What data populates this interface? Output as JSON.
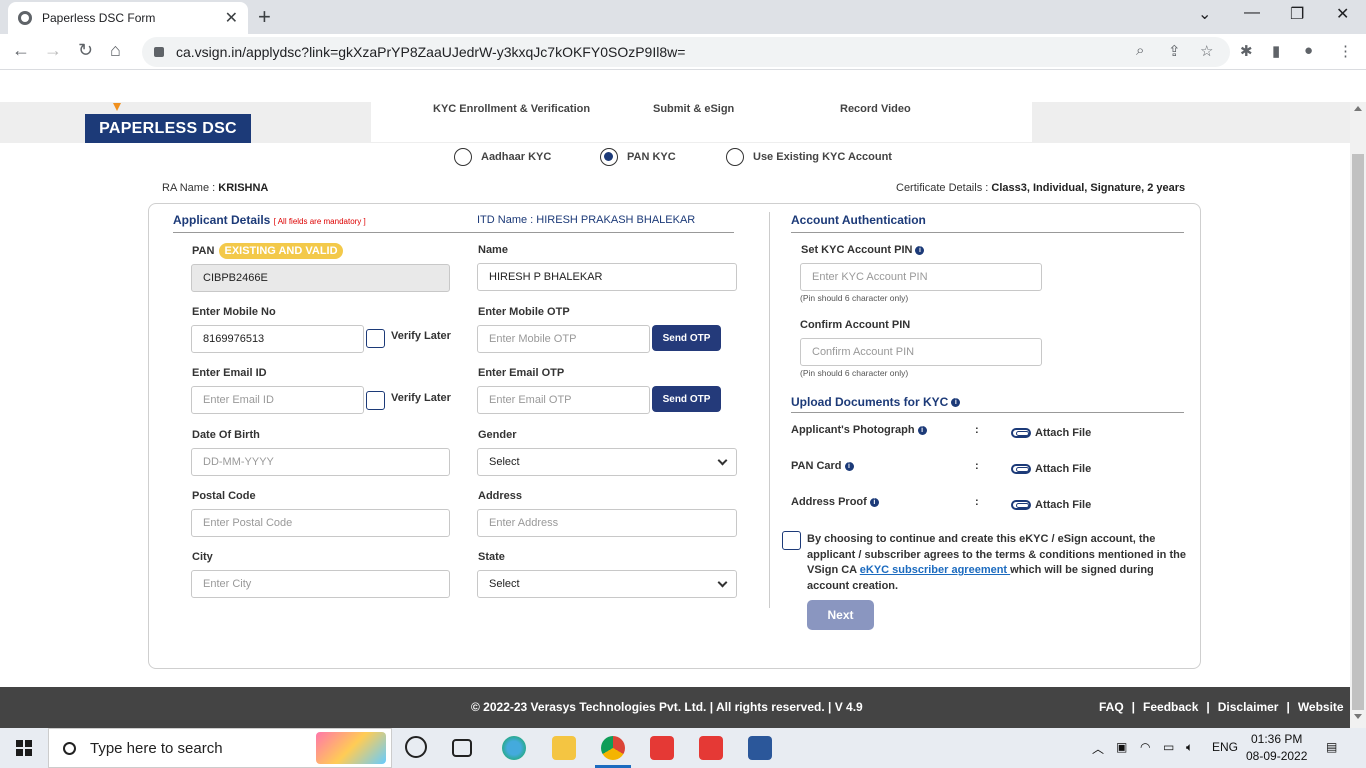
{
  "browser": {
    "tab_title": "Paperless DSC Form",
    "url": "ca.vsign.in/applydsc?link=gkXzaPrYP8ZaaUJedrW-y3kxqJc7kOKFY0SOzP9Il8w="
  },
  "header": {
    "logo": "PAPERLESS DSC",
    "steps": [
      "KYC Enrollment & Verification",
      "Submit & eSign",
      "Record Video"
    ]
  },
  "kyc_options": [
    {
      "label": "Aadhaar KYC",
      "selected": false
    },
    {
      "label": "PAN KYC",
      "selected": true
    },
    {
      "label": "Use Existing KYC Account",
      "selected": false
    }
  ],
  "ra": {
    "label": "RA Name : ",
    "value": "KRISHNA"
  },
  "cert": {
    "label": "Certificate Details : ",
    "value": "Class3, Individual, Signature, 2 years"
  },
  "applicant": {
    "title": "Applicant Details",
    "mandatory": "[ All fields are mandatory ]",
    "itd_name": "ITD Name : HIRESH PRAKASH BHALEKAR",
    "pan_label": "PAN",
    "pan_badge": "EXISTING AND VALID",
    "pan_value": "CIBPB2466E",
    "name_label": "Name",
    "name_value": "HIRESH P BHALEKAR",
    "mobile_label": "Enter Mobile No",
    "mobile_value": "8169976513",
    "verify_later": "Verify Later",
    "mobile_otp_label": "Enter Mobile OTP",
    "mobile_otp_placeholder": "Enter Mobile OTP",
    "send_otp": "Send OTP",
    "email_label": "Enter Email ID",
    "email_placeholder": "Enter Email ID",
    "email_otp_label": "Enter Email OTP",
    "email_otp_placeholder": "Enter Email OTP",
    "dob_label": "Date Of Birth",
    "dob_placeholder": "DD-MM-YYYY",
    "gender_label": "Gender",
    "gender_value": "Select",
    "postal_label": "Postal Code",
    "postal_placeholder": "Enter Postal Code",
    "address_label": "Address",
    "address_placeholder": "Enter Address",
    "city_label": "City",
    "city_placeholder": "Enter City",
    "state_label": "State",
    "state_value": "Select"
  },
  "account": {
    "title": "Account Authentication",
    "set_pin_label": "Set KYC Account PIN",
    "set_pin_placeholder": "Enter KYC Account PIN",
    "pin_hint": "(Pin should 6 character only)",
    "confirm_pin_label": "Confirm Account PIN",
    "confirm_pin_placeholder": "Confirm Account PIN",
    "upload_title": "Upload Documents for KYC",
    "docs": [
      "Applicant's Photograph",
      "PAN Card",
      "Address Proof"
    ],
    "colon": ":",
    "attach": "Attach File",
    "terms_pre": "By choosing to continue and create this eKYC / eSign account, the applicant / subscriber agrees to the terms & conditions mentioned in the VSign CA ",
    "terms_link": "eKYC subscriber agreement ",
    "terms_post": "which will be signed during account creation.",
    "next": "Next"
  },
  "footer": {
    "copyright": "© 2022-23 Verasys Technologies Pvt. Ltd. | All rights reserved. | V 4.9",
    "links": [
      "FAQ",
      "Feedback",
      "Disclaimer",
      "Website"
    ],
    "sep": "|"
  },
  "taskbar": {
    "search_placeholder": "Type here to search",
    "lang": "ENG",
    "time": "01:36 PM",
    "date": "08-09-2022"
  }
}
